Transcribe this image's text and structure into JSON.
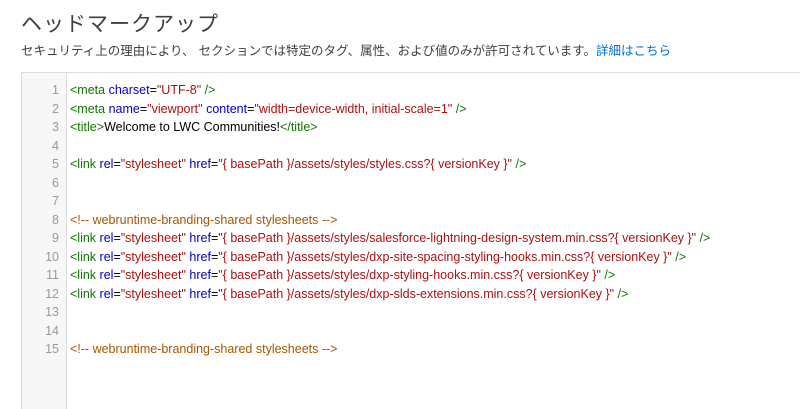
{
  "header": {
    "title": "ヘッドマークアップ",
    "description": "セキュリティ上の理由により、 セクションでは特定のタグ、属性、および値のみが許可されています。",
    "details_link": "詳細はこちら"
  },
  "editor": {
    "lines": [
      {
        "num": "1",
        "tokens": [
          {
            "t": "tag",
            "v": "<meta "
          },
          {
            "t": "attr",
            "v": "charset"
          },
          {
            "t": "txt",
            "v": "="
          },
          {
            "t": "str",
            "v": "\"UTF-8\""
          },
          {
            "t": "tag",
            "v": " />"
          }
        ]
      },
      {
        "num": "2",
        "tokens": [
          {
            "t": "tag",
            "v": "<meta "
          },
          {
            "t": "attr",
            "v": "name"
          },
          {
            "t": "txt",
            "v": "="
          },
          {
            "t": "str",
            "v": "\"viewport\""
          },
          {
            "t": "tag",
            "v": " "
          },
          {
            "t": "attr",
            "v": "content"
          },
          {
            "t": "txt",
            "v": "="
          },
          {
            "t": "str",
            "v": "\"width=device-width, initial-scale=1\""
          },
          {
            "t": "tag",
            "v": " />"
          }
        ]
      },
      {
        "num": "3",
        "tokens": [
          {
            "t": "tag",
            "v": "<title>"
          },
          {
            "t": "txt",
            "v": "Welcome to LWC Communities!"
          },
          {
            "t": "tag",
            "v": "</title>"
          }
        ]
      },
      {
        "num": "4",
        "tokens": []
      },
      {
        "num": "5",
        "tokens": [
          {
            "t": "tag",
            "v": "<link "
          },
          {
            "t": "attr",
            "v": "rel"
          },
          {
            "t": "txt",
            "v": "="
          },
          {
            "t": "str",
            "v": "\"stylesheet\""
          },
          {
            "t": "tag",
            "v": " "
          },
          {
            "t": "attr",
            "v": "href"
          },
          {
            "t": "txt",
            "v": "="
          },
          {
            "t": "str",
            "v": "\"{ basePath }/assets/styles/styles.css?{ versionKey }\""
          },
          {
            "t": "tag",
            "v": " />"
          }
        ]
      },
      {
        "num": "6",
        "tokens": []
      },
      {
        "num": "7",
        "tokens": []
      },
      {
        "num": "8",
        "tokens": [
          {
            "t": "cmt",
            "v": "<!-- webruntime-branding-shared stylesheets -->"
          }
        ]
      },
      {
        "num": "9",
        "tokens": [
          {
            "t": "tag",
            "v": "<link "
          },
          {
            "t": "attr",
            "v": "rel"
          },
          {
            "t": "txt",
            "v": "="
          },
          {
            "t": "str",
            "v": "\"stylesheet\""
          },
          {
            "t": "tag",
            "v": " "
          },
          {
            "t": "attr",
            "v": "href"
          },
          {
            "t": "txt",
            "v": "="
          },
          {
            "t": "str",
            "v": "\"{ basePath }/assets/styles/salesforce-lightning-design-system.min.css?{ versionKey }\""
          },
          {
            "t": "tag",
            "v": " />"
          }
        ]
      },
      {
        "num": "10",
        "tokens": [
          {
            "t": "tag",
            "v": "<link "
          },
          {
            "t": "attr",
            "v": "rel"
          },
          {
            "t": "txt",
            "v": "="
          },
          {
            "t": "str",
            "v": "\"stylesheet\""
          },
          {
            "t": "tag",
            "v": " "
          },
          {
            "t": "attr",
            "v": "href"
          },
          {
            "t": "txt",
            "v": "="
          },
          {
            "t": "str",
            "v": "\"{ basePath }/assets/styles/dxp-site-spacing-styling-hooks.min.css?{ versionKey }\""
          },
          {
            "t": "tag",
            "v": " />"
          }
        ]
      },
      {
        "num": "11",
        "tokens": [
          {
            "t": "tag",
            "v": "<link "
          },
          {
            "t": "attr",
            "v": "rel"
          },
          {
            "t": "txt",
            "v": "="
          },
          {
            "t": "str",
            "v": "\"stylesheet\""
          },
          {
            "t": "tag",
            "v": " "
          },
          {
            "t": "attr",
            "v": "href"
          },
          {
            "t": "txt",
            "v": "="
          },
          {
            "t": "str",
            "v": "\"{ basePath }/assets/styles/dxp-styling-hooks.min.css?{ versionKey }\""
          },
          {
            "t": "tag",
            "v": " />"
          }
        ]
      },
      {
        "num": "12",
        "tokens": [
          {
            "t": "tag",
            "v": "<link "
          },
          {
            "t": "attr",
            "v": "rel"
          },
          {
            "t": "txt",
            "v": "="
          },
          {
            "t": "str",
            "v": "\"stylesheet\""
          },
          {
            "t": "tag",
            "v": " "
          },
          {
            "t": "attr",
            "v": "href"
          },
          {
            "t": "txt",
            "v": "="
          },
          {
            "t": "str",
            "v": "\"{ basePath }/assets/styles/dxp-slds-extensions.min.css?{ versionKey }\""
          },
          {
            "t": "tag",
            "v": " />"
          }
        ]
      },
      {
        "num": "13",
        "tokens": []
      },
      {
        "num": "14",
        "tokens": []
      },
      {
        "num": "15",
        "tokens": [
          {
            "t": "cmt",
            "v": "<!-- webruntime-branding-shared stylesheets -->"
          }
        ]
      }
    ]
  },
  "colors": {
    "tag": "#117700",
    "attr": "#0000cc",
    "string": "#aa1111",
    "text": "#000000",
    "comment": "#aa5500",
    "link": "#0070d2"
  }
}
